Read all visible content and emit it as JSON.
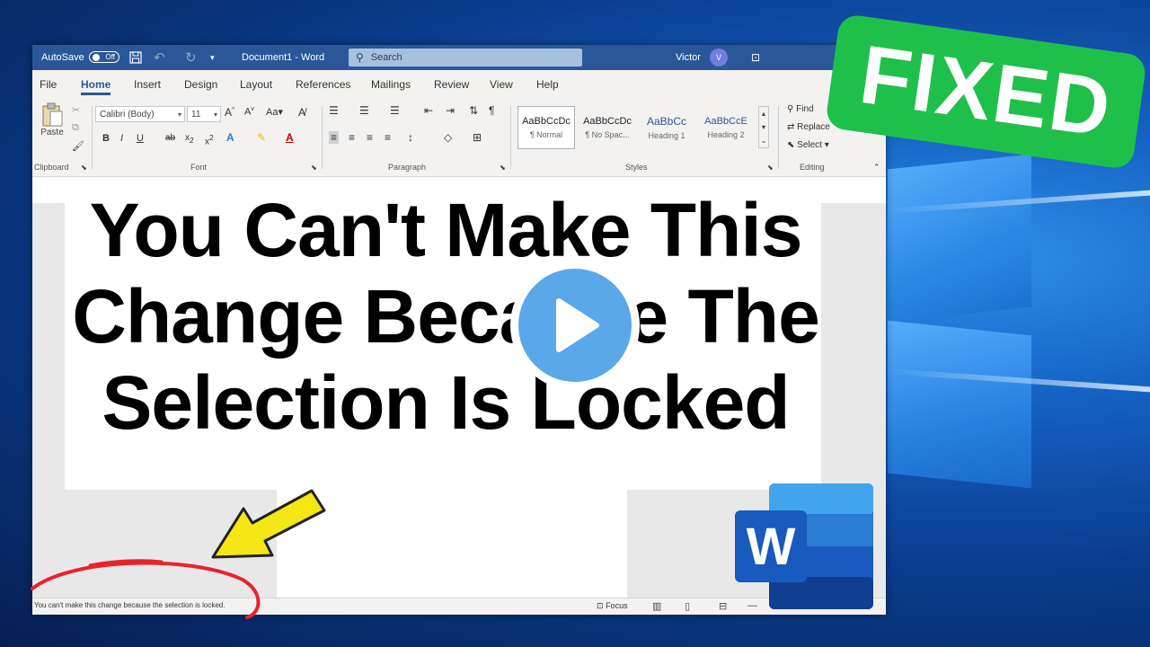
{
  "titlebar": {
    "autosave_label": "AutoSave",
    "autosave_state": "Off",
    "document_title": "Document1  -  Word",
    "search_placeholder": "Search",
    "user_name": "Victor",
    "avatar_initial": "V"
  },
  "tabs": [
    "File",
    "Home",
    "Insert",
    "Design",
    "Layout",
    "References",
    "Mailings",
    "Review",
    "View",
    "Help"
  ],
  "active_tab": "Home",
  "ribbon": {
    "clipboard": {
      "paste_label": "Paste",
      "group_label": "Clipboard"
    },
    "font": {
      "font_name": "Calibri (Body)",
      "font_size": "11",
      "group_label": "Font",
      "case_label": "Aa"
    },
    "paragraph": {
      "group_label": "Paragraph"
    },
    "styles": {
      "group_label": "Styles",
      "items": [
        {
          "preview": "AaBbCcDc",
          "name": "¶ Normal"
        },
        {
          "preview": "AaBbCcDc",
          "name": "¶ No Spac..."
        },
        {
          "preview": "AaBbCc",
          "name": "Heading 1"
        },
        {
          "preview": "AaBbCcE",
          "name": "Heading 2"
        }
      ]
    },
    "editing": {
      "find": "Find",
      "replace": "Replace",
      "select": "Select",
      "group_label": "Editing"
    }
  },
  "status_bar": {
    "message": "You can't make this change because the selection is locked.",
    "focus_label": "Focus"
  },
  "overlay": {
    "headline_lines": [
      "You Can't Make This",
      "Change Because The",
      "Selection Is Locked"
    ],
    "badge": "FIXED",
    "logo_letter": "W"
  },
  "colors": {
    "word_blue": "#2b579a",
    "badge_green": "#1fc04a",
    "play_blue": "#5aa8ea",
    "arrow_yellow": "#f5e616",
    "circle_red": "#e8232a"
  }
}
